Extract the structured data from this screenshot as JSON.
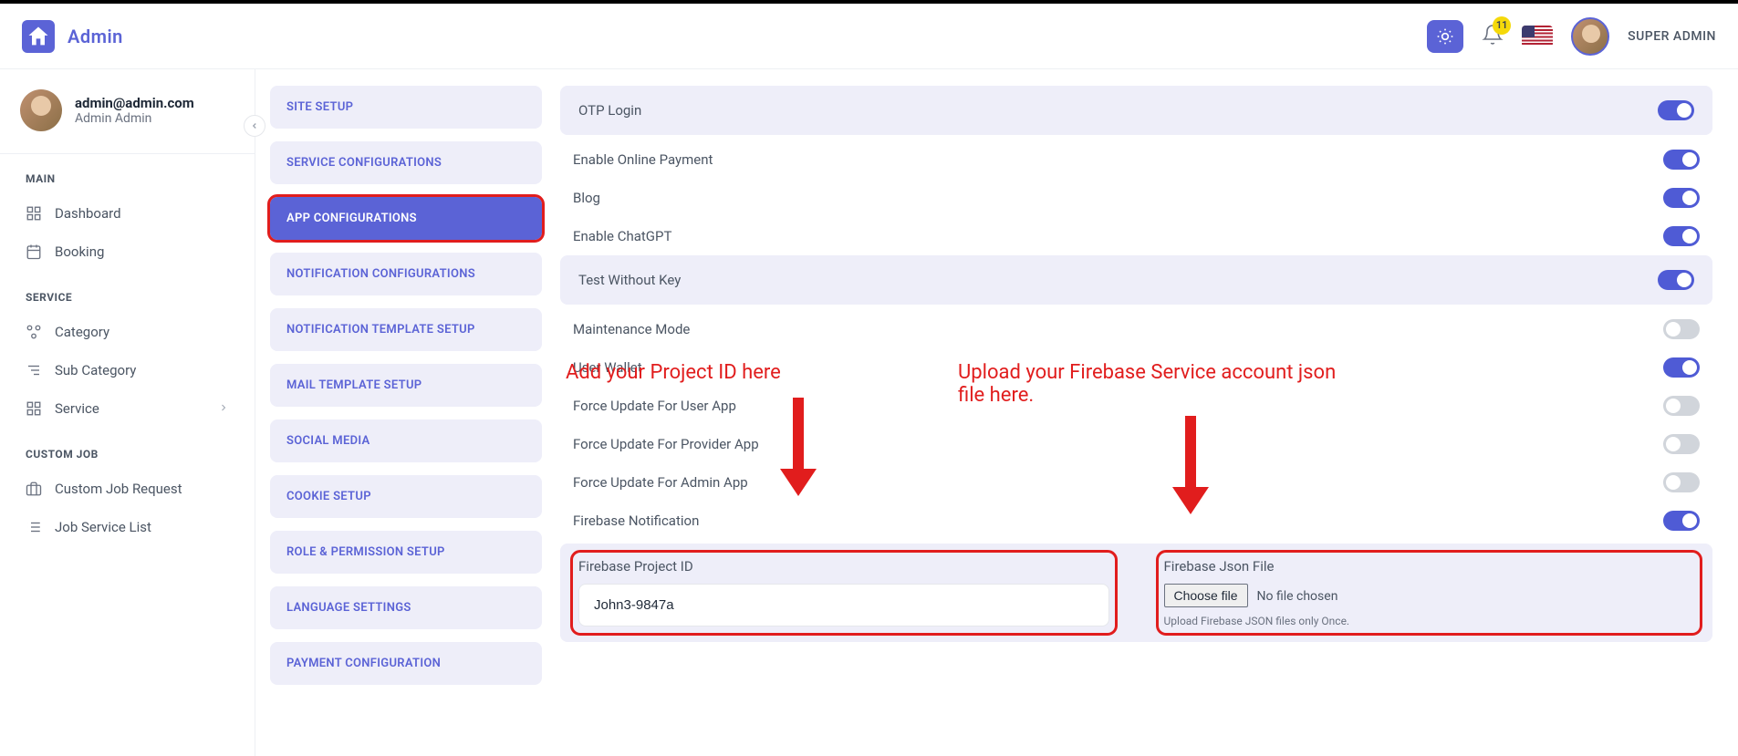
{
  "brand": "Admin",
  "header": {
    "notif_count": "11",
    "user_label": "SUPER ADMIN"
  },
  "profile": {
    "email": "admin@admin.com",
    "name": "Admin Admin"
  },
  "side_sections": {
    "main_title": "MAIN",
    "service_title": "SERVICE",
    "custom_title": "CUSTOM JOB"
  },
  "side_items": {
    "dashboard": "Dashboard",
    "booking": "Booking",
    "category": "Category",
    "subcategory": "Sub Category",
    "service": "Service",
    "custom_request": "Custom Job Request",
    "job_service_list": "Job Service List"
  },
  "config_nav": {
    "site_setup": "SITE SETUP",
    "service_config": "SERVICE CONFIGURATIONS",
    "app_config": "APP CONFIGURATIONS",
    "notif_config": "NOTIFICATION CONFIGURATIONS",
    "notif_template": "NOTIFICATION TEMPLATE SETUP",
    "mail_template": "MAIL TEMPLATE SETUP",
    "social_media": "SOCIAL MEDIA",
    "cookie_setup": "COOKIE SETUP",
    "role_perm": "ROLE & PERMISSION SETUP",
    "lang_settings": "LANGUAGE SETTINGS",
    "payment_config": "PAYMENT CONFIGURATION"
  },
  "toggles": {
    "otp_login": {
      "label": "OTP Login",
      "on": true,
      "boxed": true
    },
    "online_payment": {
      "label": "Enable Online Payment",
      "on": true,
      "boxed": false
    },
    "blog": {
      "label": "Blog",
      "on": true,
      "boxed": false
    },
    "chatgpt": {
      "label": "Enable ChatGPT",
      "on": true,
      "boxed": false
    },
    "test_no_key": {
      "label": "Test Without Key",
      "on": true,
      "boxed": true
    },
    "maintenance": {
      "label": "Maintenance Mode",
      "on": false,
      "boxed": false
    },
    "user_wallet": {
      "label": "User Wallet",
      "on": true,
      "boxed": false
    },
    "force_user": {
      "label": "Force Update For User App",
      "on": false,
      "boxed": false
    },
    "force_provider": {
      "label": "Force Update For Provider App",
      "on": false,
      "boxed": false
    },
    "force_admin": {
      "label": "Force Update For Admin App",
      "on": false,
      "boxed": false
    },
    "firebase_notif": {
      "label": "Firebase Notification",
      "on": true,
      "boxed": false
    }
  },
  "firebase": {
    "project_id_label": "Firebase Project ID",
    "project_id_value": "John3-9847a",
    "json_label": "Firebase Json File",
    "choose_file": "Choose file",
    "no_file": "No file chosen",
    "hint": "Upload Firebase JSON files only Once."
  },
  "annotations": {
    "project_id": "Add your Project ID here",
    "json_upload": "Upload your Firebase Service account json file here."
  }
}
